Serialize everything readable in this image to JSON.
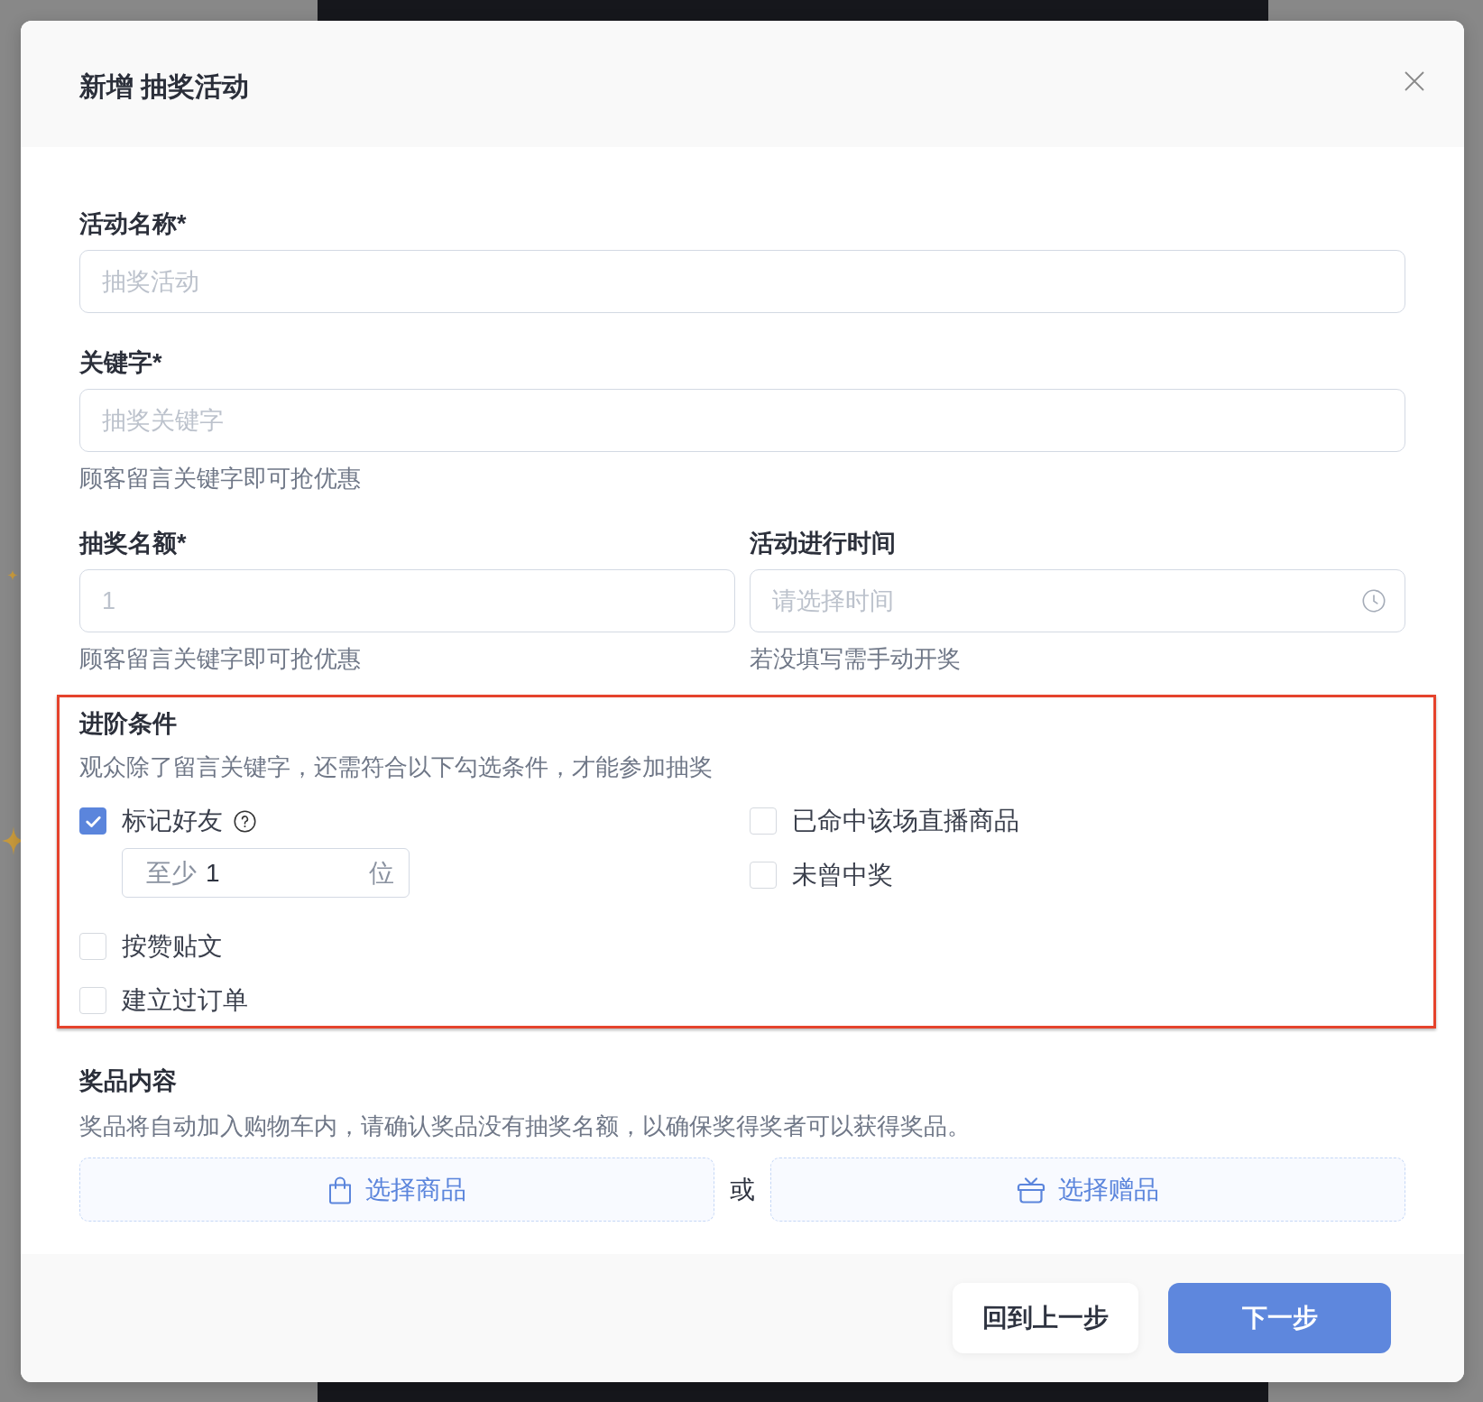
{
  "dialog": {
    "title": "新增 抽奖活动"
  },
  "form_rows": [
    {
      "fields": [
        {
          "kind": "text",
          "label": "活动名称*",
          "placeholder": "抽奖活动"
        }
      ]
    },
    {
      "fields": [
        {
          "kind": "text",
          "label": "关键字*",
          "placeholder": "抽奖关键字",
          "help_text": "顾客留言关键字即可抢优惠"
        }
      ]
    },
    {
      "fields": [
        {
          "kind": "text",
          "label": "抽奖名额*",
          "placeholder": "1",
          "help_text": "顾客留言关键字即可抢优惠"
        },
        {
          "kind": "time",
          "label": "活动进行时间",
          "placeholder": "请选择时间",
          "help_text": "若没填写需手动开奖"
        }
      ]
    }
  ],
  "advanced": {
    "highlighted": true,
    "title": "进阶条件",
    "description": "观众除了留言关键字，还需符合以下勾选条件，才能参加抽奖",
    "columns": [
      {
        "conditions": [
          {
            "label": "标记好友",
            "checked": true,
            "help": true,
            "min_count": {
              "prefix": "至少",
              "value": "1",
              "suffix": "位"
            }
          },
          {
            "label": "按赞贴文",
            "checked": false
          },
          {
            "label": "建立过订单",
            "checked": false
          }
        ]
      },
      {
        "conditions": [
          {
            "label": "已命中该场直播商品",
            "checked": false
          },
          {
            "label": "未曾中奖",
            "checked": false
          }
        ]
      }
    ]
  },
  "prizes": {
    "title": "奖品内容",
    "description": "奖品将自动加入购物车内，请确认奖品没有抽奖名额，以确保奖得奖者可以获得奖品。",
    "options": [
      {
        "kind": "product",
        "label": "选择商品"
      },
      {
        "kind": "gift",
        "label": "选择赠品"
      }
    ],
    "separator": "或"
  },
  "footer": {
    "buttons": [
      {
        "kind": "secondary",
        "label": "回到上一步"
      },
      {
        "kind": "primary",
        "label": "下一步"
      }
    ]
  }
}
